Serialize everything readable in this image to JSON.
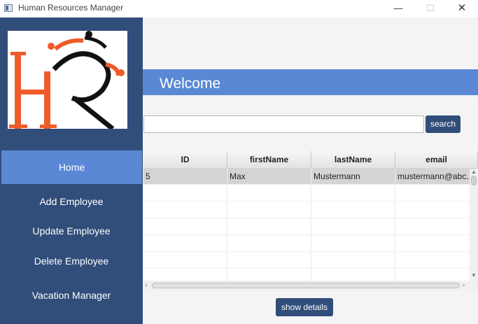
{
  "window": {
    "title": "Human Resources Manager",
    "minimize_glyph": "—",
    "maximize_glyph": "☐",
    "close_glyph": "✕"
  },
  "sidebar": {
    "items": [
      {
        "label": "Home",
        "active": true
      },
      {
        "label": "Add Employee",
        "active": false
      },
      {
        "label": "Update Employee",
        "active": false
      },
      {
        "label": "Delete Employee",
        "active": false
      },
      {
        "label": "Vacation Manager",
        "active": false
      }
    ]
  },
  "main": {
    "welcome": "Welcome",
    "search": {
      "value": "",
      "placeholder": "",
      "button_label": "search"
    },
    "table": {
      "columns": [
        "ID",
        "firstName",
        "lastName",
        "email"
      ],
      "rows": [
        [
          "5",
          "Max",
          "Mustermann",
          "mustermann@abc..."
        ]
      ]
    },
    "details_button_label": "show details"
  },
  "colors": {
    "sidebar": "#314d7a",
    "accent": "#5a88d4",
    "logo_orange": "#ef5a2b",
    "logo_dark": "#111111"
  },
  "icons": {
    "logo": "hr-logo",
    "scroll_up": "chevron-up-icon",
    "scroll_down": "chevron-down-icon",
    "scroll_left": "chevron-left-icon",
    "scroll_right": "chevron-right-icon"
  }
}
